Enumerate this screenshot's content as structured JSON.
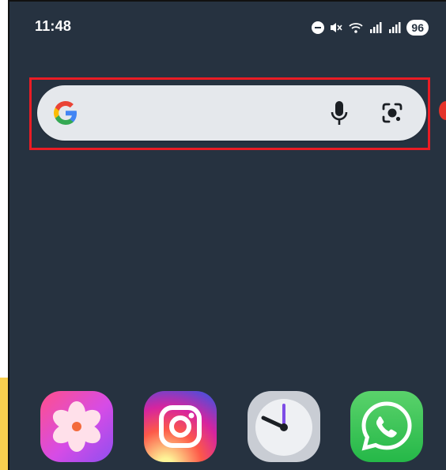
{
  "status_bar": {
    "time": "11:48",
    "battery": "96",
    "icons": [
      "dnd-icon",
      "mute-icon",
      "wifi-icon",
      "signal-icon-1",
      "signal-icon-2"
    ]
  },
  "search_widget": {
    "icons": [
      "google-g-logo",
      "mic-icon",
      "google-lens-icon"
    ]
  },
  "dock": {
    "apps": [
      {
        "name": "gallery-app",
        "colors": [
          "#ff5fa2",
          "#c14cf0"
        ]
      },
      {
        "name": "instagram-app",
        "colors": [
          "#feda75",
          "#d62976",
          "#962fbf"
        ]
      },
      {
        "name": "clock-app",
        "colors": [
          "#e6e9ee",
          "#7d4ce6"
        ]
      },
      {
        "name": "whatsapp-app",
        "colors": [
          "#25d366"
        ]
      }
    ]
  },
  "colors": {
    "wallpaper": "#263240",
    "highlight": "#ea1c24",
    "search_bg": "#e5e8ec"
  }
}
